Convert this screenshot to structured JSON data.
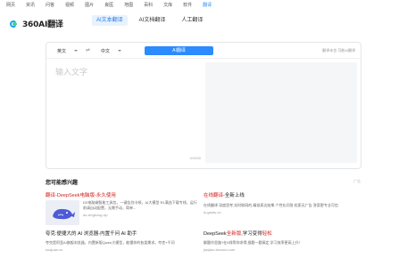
{
  "topnav": {
    "items": [
      "网页",
      "资讯",
      "问答",
      "视频",
      "图片",
      "良医",
      "地图",
      "百科",
      "文库",
      "软件",
      "翻译"
    ],
    "active_index": 10
  },
  "header": {
    "logo_text": "360AI翻译",
    "tabs": [
      "AI文本翻译",
      "AI文档翻译",
      "人工翻译"
    ],
    "active_tab": 0
  },
  "translator": {
    "source_lang": "英文",
    "target_lang": "中文",
    "swap_icon": "⇌",
    "translate_label": "AI翻译",
    "right_hint": "翻译未也 可能AI翻译",
    "input_placeholder": "输入文字",
    "char_counter": "0/3000"
  },
  "recommend": {
    "title": "您可能感兴趣",
    "hint": "广告",
    "ads": [
      {
        "title_hl": "翻译",
        "title_rest": "-DeepSeek电脑版-永久使用",
        "desc": "DS电脑端智能工具包，一键告别卡顿，AI大模型·R1满血下载专线，运行前请自动配置，无需手动，简单...",
        "domain": "ds.xingkong.vip"
      },
      {
        "title_hl": "在线翻译",
        "title_rest": "-全新上线",
        "desc": "在线翻译 深度思考,实时联网的,精准表达结果-个性化问答,检索无广告 答案更专业可信.",
        "domain": "lu.gaofu.cn"
      },
      {
        "title_hl": "",
        "title_rest": "夸克:便捷大的 AI 浏览器-内置千问 AI 助手",
        "desc": "夸克是阿里AI旗舰浏览器，内置新版Qwen大模型，能懂你的各类需求。夸克+千问",
        "domain": "kuajuan.cn"
      },
      {
        "title_hl": "",
        "title_rest": "DeepSeek全新版,学习变得轻松",
        "desc": "解题作思路?在5线等你求得,搜题一题搞定,学习效率更高上升！",
        "domain": "jiaojiao.kecond.com"
      }
    ]
  },
  "colors": {
    "accent": "#2b8bff",
    "highlight": "#d21e1e"
  }
}
